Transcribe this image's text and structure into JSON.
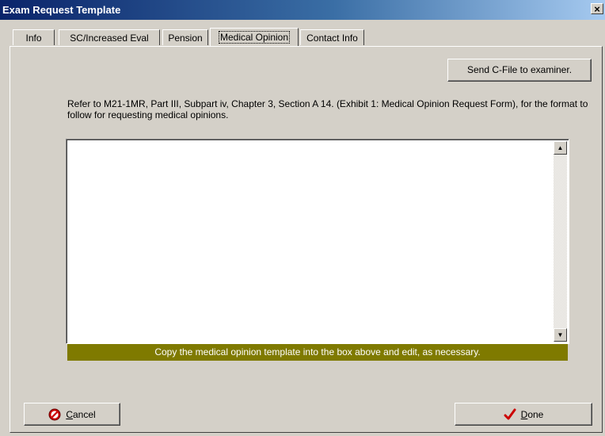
{
  "window": {
    "title": "Exam Request Template",
    "close_label": "×"
  },
  "tabs": [
    {
      "label": "Info"
    },
    {
      "label": "SC/Increased Eval"
    },
    {
      "label": "Pension"
    },
    {
      "label": "Medical Opinion",
      "active": true
    },
    {
      "label": "Contact Info"
    }
  ],
  "send_button": {
    "label": "Send C-File to examiner."
  },
  "instructions": "Refer to M21-1MR, Part III, Subpart iv, Chapter 3, Section A 14. (Exhibit 1: Medical Opinion Request Form), for the format to follow for requesting medical opinions.",
  "editor": {
    "value": ""
  },
  "hint": "Copy the medical opinion template into the box above and edit, as necessary.",
  "cancel_button": {
    "mnemonic": "C",
    "rest": "ancel"
  },
  "done_button": {
    "mnemonic": "D",
    "rest": "one"
  },
  "colors": {
    "hint_bar": "#7f7a00",
    "done_check": "#cc0000",
    "cancel_icon": "#cc0000"
  },
  "icons": {
    "cancel": "no-entry-icon",
    "done": "red-checkmark-icon"
  }
}
